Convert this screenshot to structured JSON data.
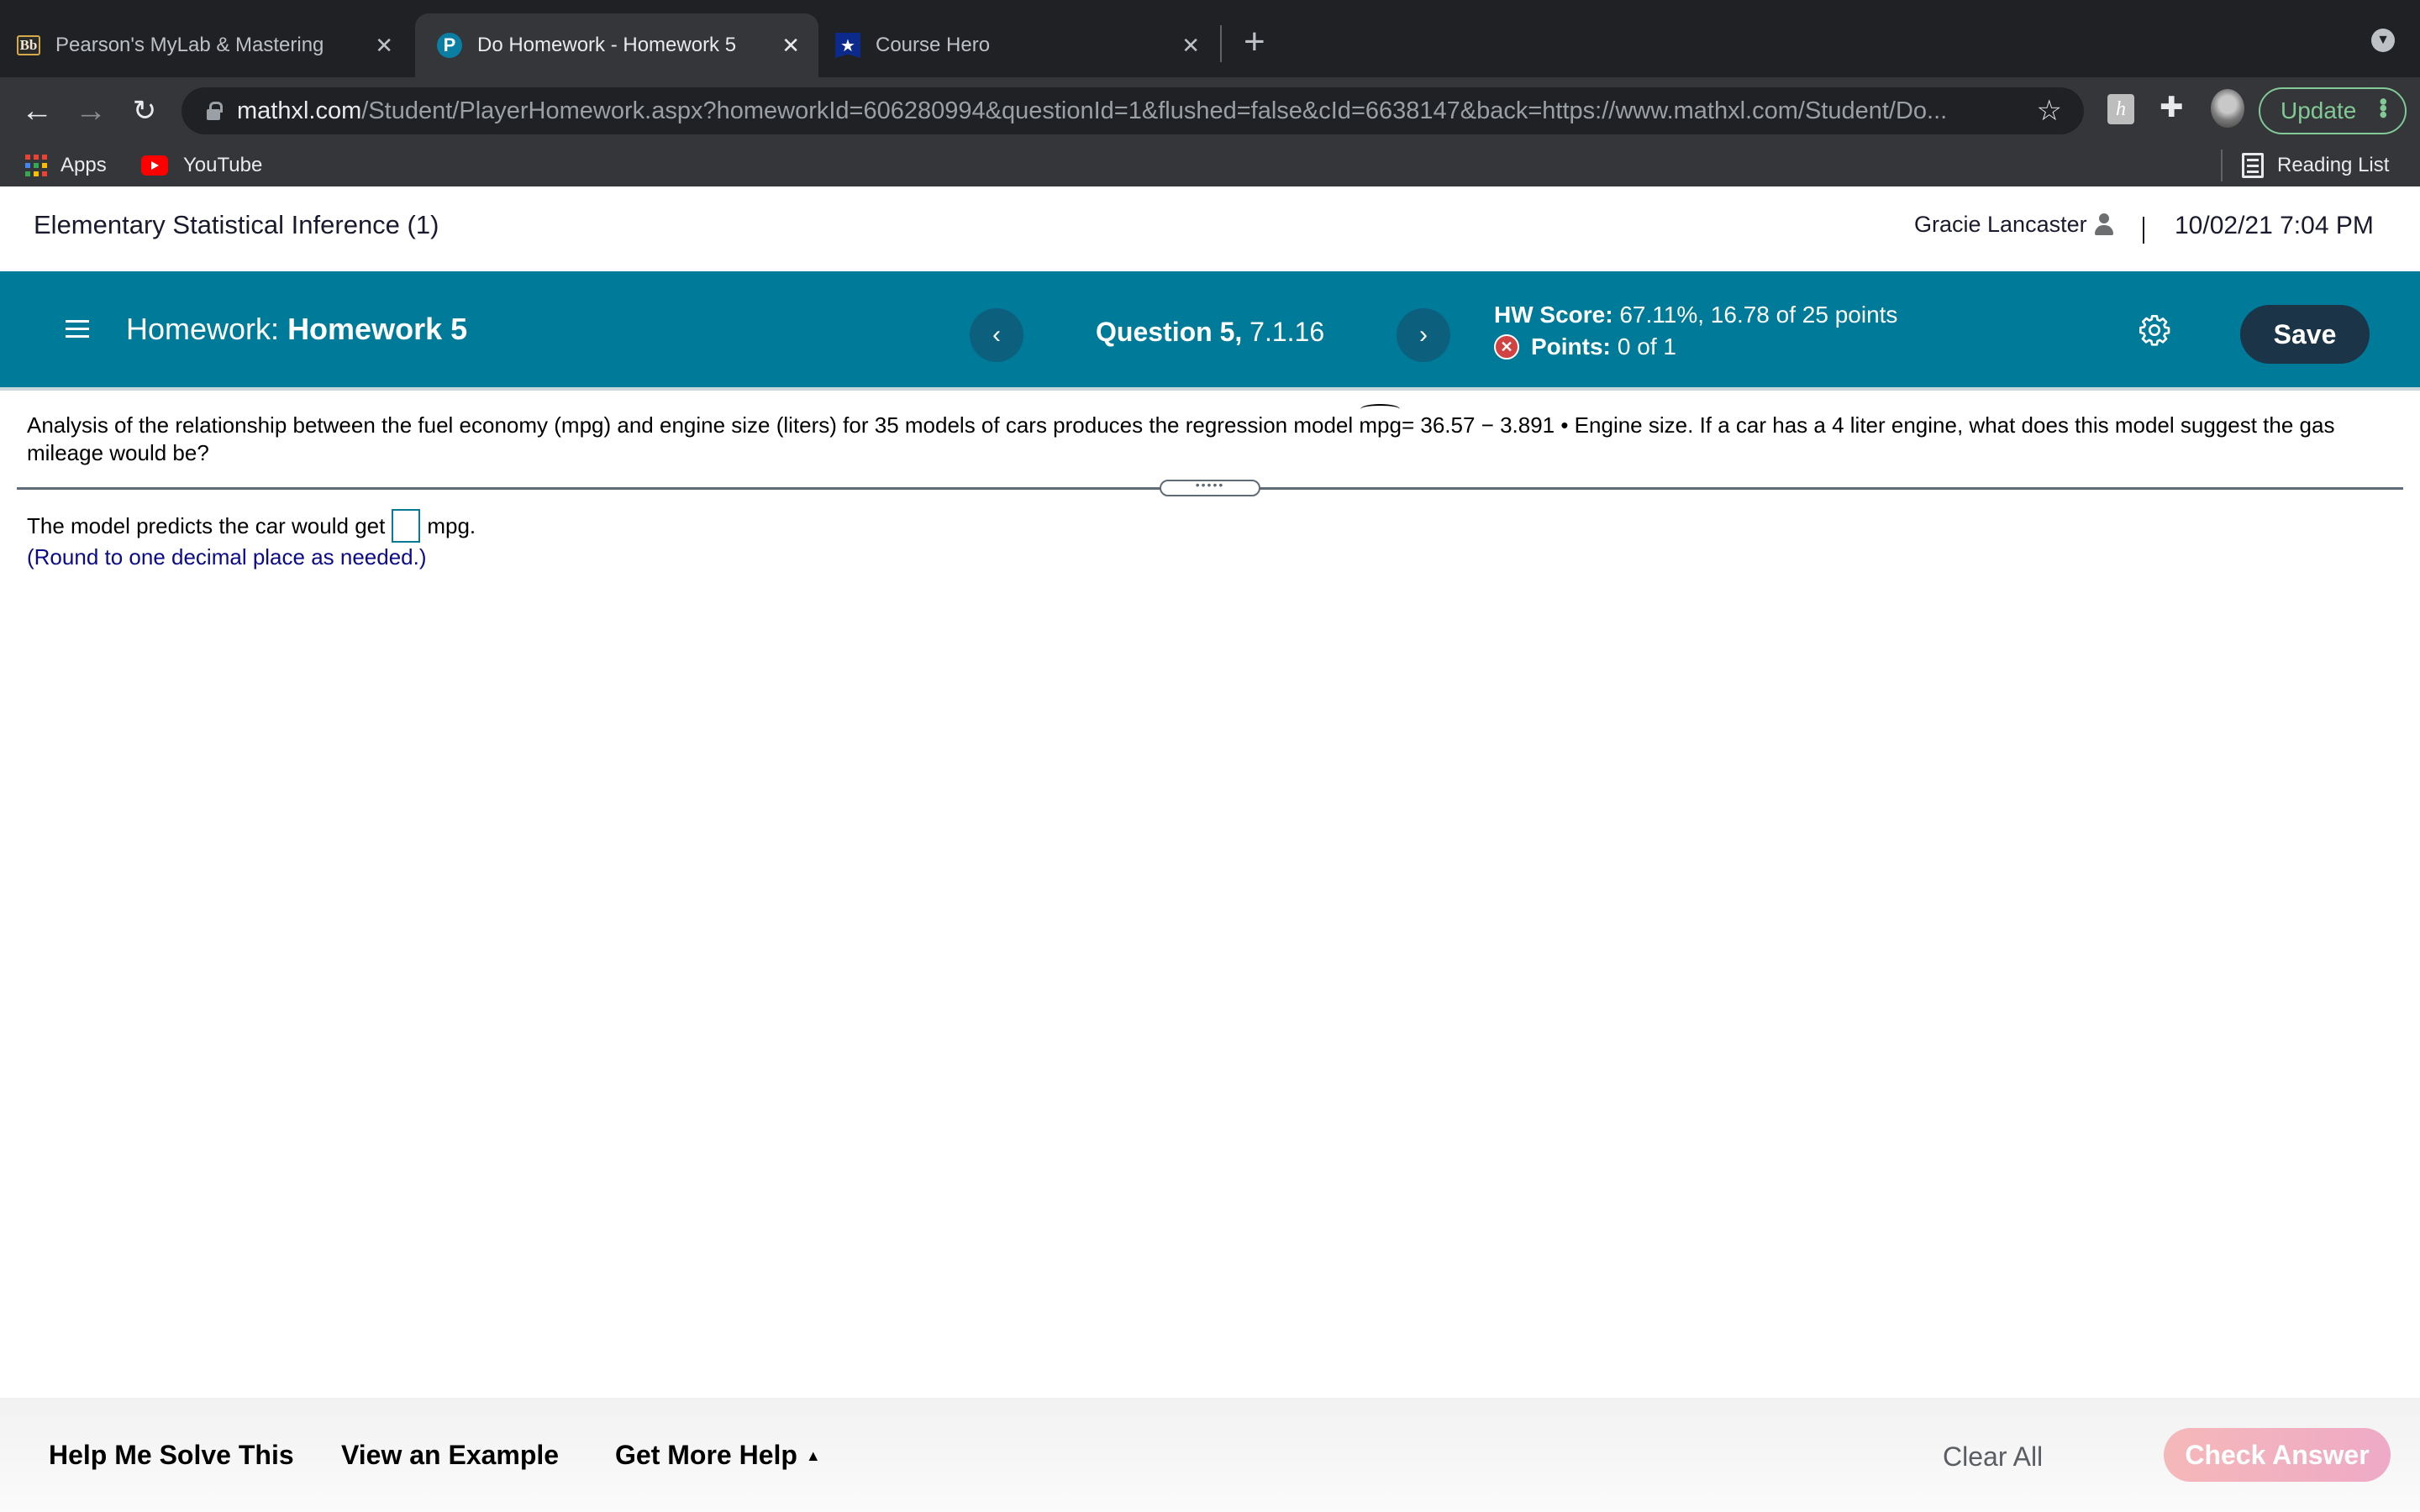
{
  "browser": {
    "tabs": [
      {
        "title": "Pearson's MyLab & Mastering",
        "favicon": "blackboard-icon",
        "active": false
      },
      {
        "title": "Do Homework - Homework 5",
        "favicon": "pearson-icon",
        "active": true
      },
      {
        "title": "Course Hero",
        "favicon": "coursehero-icon",
        "active": false
      }
    ],
    "tab_close_glyph": "✕",
    "new_tab_glyph": "+",
    "url_host": "mathxl.com",
    "url_path": "/Student/PlayerHomework.aspx?homeworkId=606280994&questionId=1&flushed=false&cId=6638147&back=https://www.mathxl.com/Student/Do...",
    "update_label": "Update",
    "extension_h": "h",
    "bookmarks": [
      {
        "label": "Apps",
        "icon": "apps-grid-icon"
      },
      {
        "label": "YouTube",
        "icon": "youtube-icon"
      }
    ],
    "reading_list_label": "Reading List"
  },
  "course": {
    "title": "Elementary Statistical Inference (1)",
    "user_name": "Gracie Lancaster",
    "datetime": "10/02/21 7:04 PM"
  },
  "homework_bar": {
    "prefix": "Homework:",
    "name": "Homework 5",
    "question_label": "Question 5,",
    "question_id": "7.1.16",
    "prev_glyph": "‹",
    "next_glyph": "›",
    "hw_score_label": "HW Score:",
    "hw_score_value": "67.11%, 16.78 of 25 points",
    "points_label": "Points:",
    "points_value": "0 of 1",
    "save_label": "Save",
    "accent_color": "#007a99"
  },
  "question": {
    "text_before": "Analysis of the relationship between the fuel economy (mpg) and engine size (liters) for 35 models of cars produces the regression model",
    "model_var": "mpg",
    "model_equation": "= 36.57 − 3.891 • Engine size.",
    "text_after": "If a car has a 4 liter engine, what does this model suggest the gas mileage would be?",
    "expander_glyph": "•••••"
  },
  "answer": {
    "prefix": "The model predicts the car would get",
    "value": "",
    "suffix": "mpg.",
    "hint": "(Round to one decimal place as needed.)"
  },
  "footer": {
    "help_me_solve": "Help Me Solve This",
    "view_example": "View an Example",
    "get_more_help": "Get More Help",
    "get_more_help_caret": "▲",
    "clear_all": "Clear All",
    "check_answer": "Check Answer"
  }
}
